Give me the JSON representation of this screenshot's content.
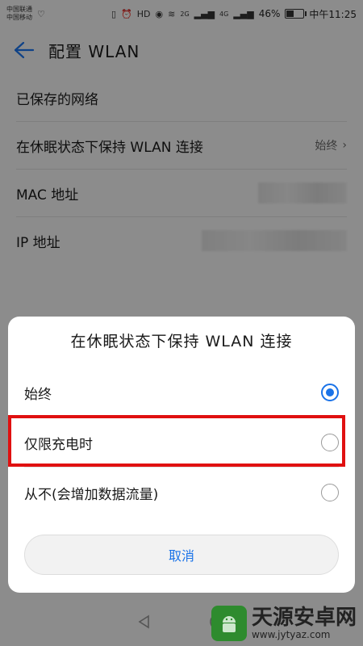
{
  "status_bar": {
    "carrier_1": "中国联通",
    "carrier_2": "中国移动",
    "battery": "46%",
    "battery_level_pct": 46,
    "time": "中午11:25",
    "network_2g": "2G",
    "network_4g": "4G"
  },
  "appbar": {
    "title": "配置 WLAN"
  },
  "settings": {
    "saved_networks": "已保存的网络",
    "keep_wlan_label": "在休眠状态下保持 WLAN 连接",
    "keep_wlan_value": "始终",
    "mac_label": "MAC 地址",
    "ip_label": "IP 地址"
  },
  "dialog": {
    "title": "在休眠状态下保持 WLAN 连接",
    "options": [
      {
        "label": "始终",
        "checked": true
      },
      {
        "label": "仅限充电时",
        "checked": false
      },
      {
        "label": "从不(会增加数据流量)",
        "checked": false
      }
    ],
    "cancel": "取消"
  },
  "watermark": {
    "main": "天源安卓网",
    "sub": "www.jytyaz.com"
  },
  "colors": {
    "accent": "#1a73e8",
    "highlight": "#e01010"
  }
}
